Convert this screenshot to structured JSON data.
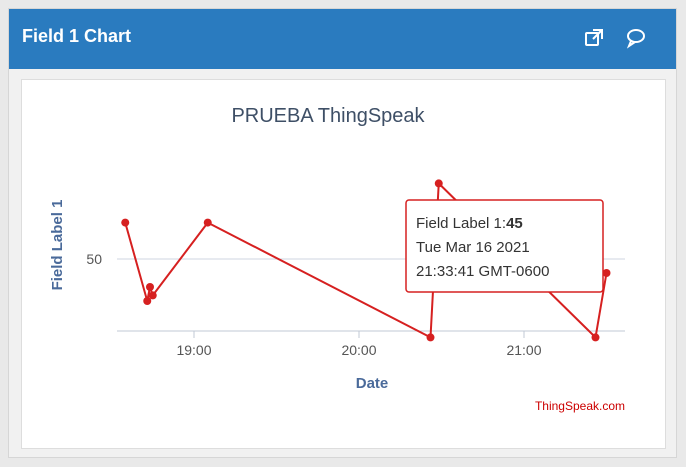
{
  "widget": {
    "title": "Field 1 Chart",
    "icons": [
      "external-link-icon",
      "comment-icon"
    ]
  },
  "chart_data": {
    "type": "line",
    "title": "PRUEBA ThingSpeak",
    "xlabel": "Date",
    "ylabel": "Field Label 1",
    "series": [
      {
        "name": "Field Label 1",
        "color": "#d62020",
        "x": [
          "18:35",
          "18:43",
          "18:44",
          "18:45",
          "19:05",
          "20:26",
          "20:29",
          "21:26",
          "21:30"
        ],
        "y": [
          63,
          35,
          40,
          37,
          63,
          22,
          77,
          22,
          45
        ]
      }
    ],
    "x_ticks": [
      "19:00",
      "20:00",
      "21:00"
    ],
    "y_ticks": [
      50
    ],
    "grid": true,
    "tooltip": {
      "label": "Field Label 1:",
      "value": "45",
      "date": "Tue Mar 16 2021",
      "time": "21:33:41 GMT-0600"
    },
    "credit": "ThingSpeak.com"
  }
}
